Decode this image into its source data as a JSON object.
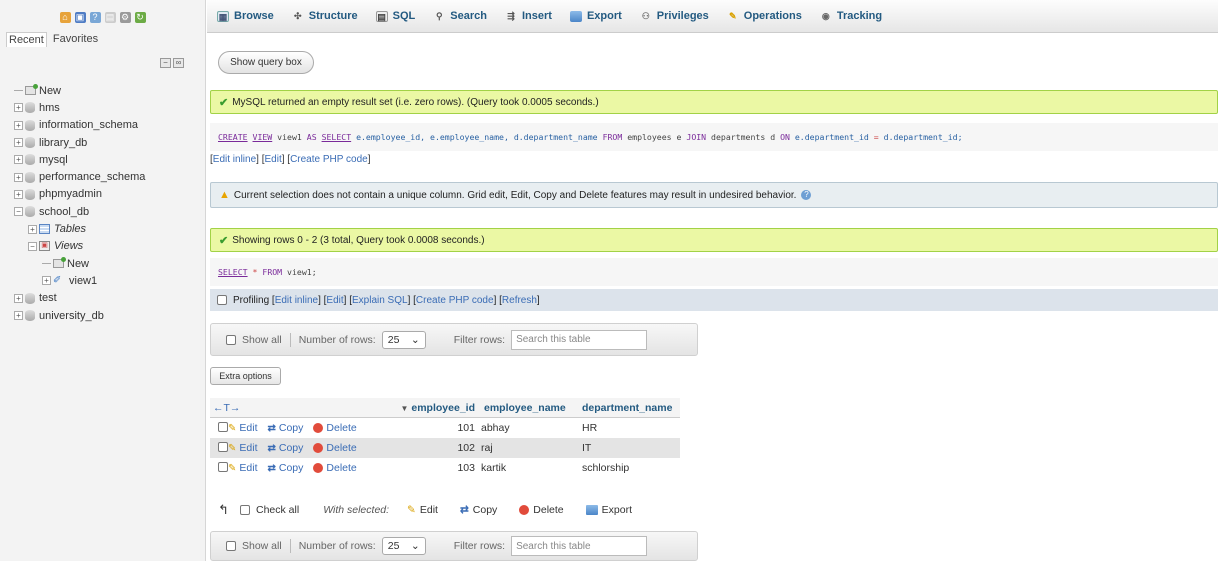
{
  "nav": {
    "tabs": [
      "Recent",
      "Favorites"
    ],
    "tree": [
      {
        "label": "New",
        "kind": "new",
        "depth": 0
      },
      {
        "label": "hms",
        "kind": "db",
        "depth": 0
      },
      {
        "label": "information_schema",
        "kind": "db",
        "depth": 0
      },
      {
        "label": "library_db",
        "kind": "db",
        "depth": 0
      },
      {
        "label": "mysql",
        "kind": "db",
        "depth": 0
      },
      {
        "label": "performance_schema",
        "kind": "db",
        "depth": 0
      },
      {
        "label": "phpmyadmin",
        "kind": "db",
        "depth": 0
      },
      {
        "label": "school_db",
        "kind": "db-open",
        "depth": 0
      },
      {
        "label": "Tables",
        "kind": "tables",
        "depth": 1
      },
      {
        "label": "Views",
        "kind": "views",
        "depth": 1
      },
      {
        "label": "New",
        "kind": "new",
        "depth": 2
      },
      {
        "label": "view1",
        "kind": "view",
        "depth": 2
      },
      {
        "label": "test",
        "kind": "db",
        "depth": 0
      },
      {
        "label": "university_db",
        "kind": "db",
        "depth": 0
      }
    ]
  },
  "menu": {
    "tabs": [
      "Browse",
      "Structure",
      "SQL",
      "Search",
      "Insert",
      "Export",
      "Privileges",
      "Operations",
      "Tracking"
    ]
  },
  "content": {
    "show_query_box": "Show query box",
    "msg1": "MySQL returned an empty result set (i.e. zero rows). (Query took 0.0005 seconds.)",
    "sql1": {
      "create": "CREATE",
      "view": "VIEW",
      "name": "view1",
      "as": "AS",
      "select": "SELECT",
      "cols": "e.employee_id, e.employee_name, d.department_name",
      "from": "FROM",
      "t1": "employees e",
      "join": "JOIN",
      "t2": "departments d",
      "on": "ON",
      "c1": "e.department_id",
      "eq": "=",
      "c2": "d.department_id;"
    },
    "links1": [
      "Edit inline",
      "Edit",
      "Create PHP code"
    ],
    "warn": "Current selection does not contain a unique column. Grid edit, Edit, Copy and Delete features may result in undesired behavior.",
    "msg2": "Showing rows 0 - 2 (3 total, Query took 0.0008 seconds.)",
    "sql2": {
      "select": "SELECT",
      "star": "*",
      "from": "FROM",
      "table": "view1;"
    },
    "profiling": "Profiling",
    "links2": [
      "Edit inline",
      "Edit",
      "Explain SQL",
      "Create PHP code",
      "Refresh"
    ],
    "navbar": {
      "show_all": "Show all",
      "num_rows_label": "Number of rows:",
      "num_rows_value": "25",
      "filter_label": "Filter rows:",
      "filter_placeholder": "Search this table"
    },
    "extra_options": "Extra options",
    "table": {
      "sort_arrows": "←T→",
      "columns": [
        "employee_id",
        "employee_name",
        "department_name"
      ],
      "actions": {
        "edit": "Edit",
        "copy": "Copy",
        "delete": "Delete"
      },
      "rows": [
        {
          "employee_id": "101",
          "employee_name": "abhay",
          "department_name": "HR"
        },
        {
          "employee_id": "102",
          "employee_name": "raj",
          "department_name": "IT"
        },
        {
          "employee_id": "103",
          "employee_name": "kartik",
          "department_name": "schlorship"
        }
      ]
    },
    "with_selected": {
      "check_all": "Check all",
      "label": "With selected:",
      "edit": "Edit",
      "copy": "Copy",
      "delete": "Delete",
      "export": "Export"
    }
  },
  "colors": {
    "link": "#3a6cb5",
    "header_text": "#235a81",
    "success_bg": "#ebf8a4",
    "notice_bg": "#e8eef1",
    "keyword": "#7a2a9a"
  }
}
